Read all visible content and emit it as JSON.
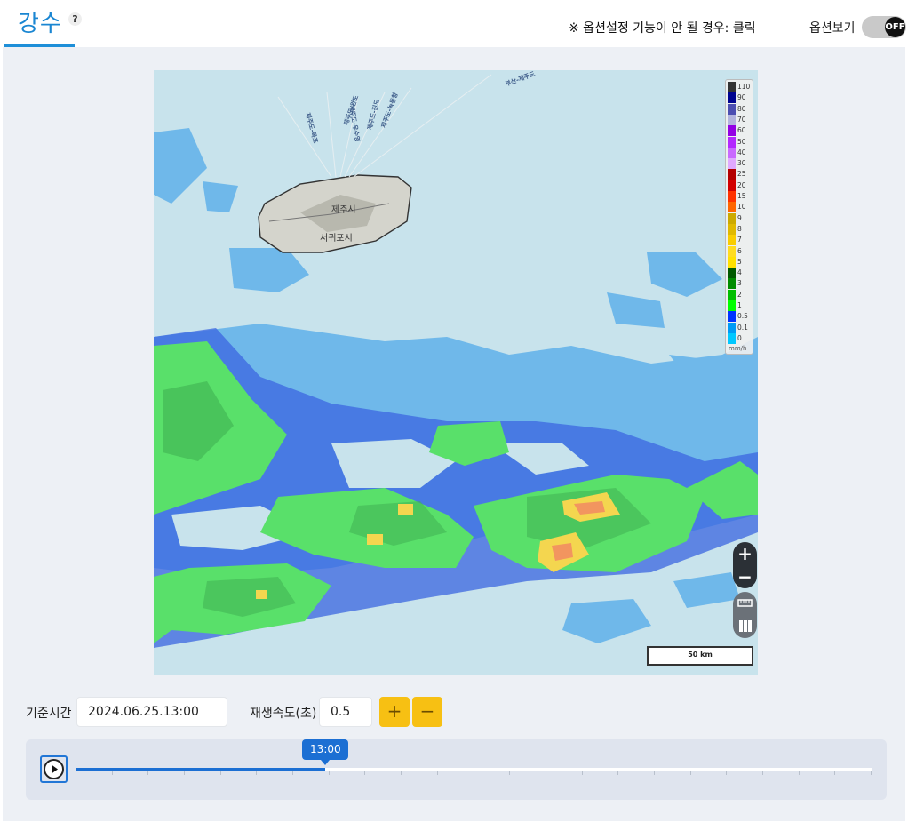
{
  "header": {
    "tab_title": "강수",
    "help_icon": "?",
    "notice": "※ 옵션설정 기능이 안 될 경우: 클릭",
    "option_label": "옵션보기",
    "toggle_state": "OFF"
  },
  "map": {
    "places": {
      "jeju_city": "제주시",
      "seogwipo": "서귀포시"
    },
    "routes": [
      "제주도-목포",
      "제주도-완도",
      "제주도-진도",
      "제주도-우수영",
      "제주도-녹동항",
      "제주도-여수",
      "부산-제주도"
    ],
    "legend": {
      "values": [
        "110",
        "90",
        "80",
        "70",
        "60",
        "50",
        "40",
        "30",
        "25",
        "20",
        "15",
        "10",
        "9",
        "8",
        "7",
        "6",
        "5",
        "4",
        "3",
        "2",
        "1",
        "0.5",
        "0.1",
        "0"
      ],
      "colors": [
        "#333333",
        "#000390",
        "#4c4eb1",
        "#b3b4de",
        "#9300e4",
        "#b329ff",
        "#c969ff",
        "#e0a9ff",
        "#b40000",
        "#d20000",
        "#ff3200",
        "#ff6600",
        "#ccaa00",
        "#e0b900",
        "#f9cd00",
        "#ffdc1f",
        "#ffe100",
        "#005a00",
        "#008c00",
        "#00be00",
        "#00ff00",
        "#0033ff",
        "#009bf5",
        "#00c8ff"
      ],
      "unit": "mm/h"
    },
    "zoom_in": "+",
    "zoom_out": "−",
    "scale_label": "50 km",
    "icons": {
      "ruler": "ruler-icon",
      "layers": "layers-icon"
    }
  },
  "controls": {
    "base_time_label": "기준시간",
    "base_time_value": "2024.06.25.13:00",
    "speed_label": "재생속도(초)",
    "speed_value": "0.5",
    "plus": "+",
    "minus": "−"
  },
  "timeline": {
    "current_time": "13:00",
    "progress": 0.314,
    "tick_count": 23
  }
}
